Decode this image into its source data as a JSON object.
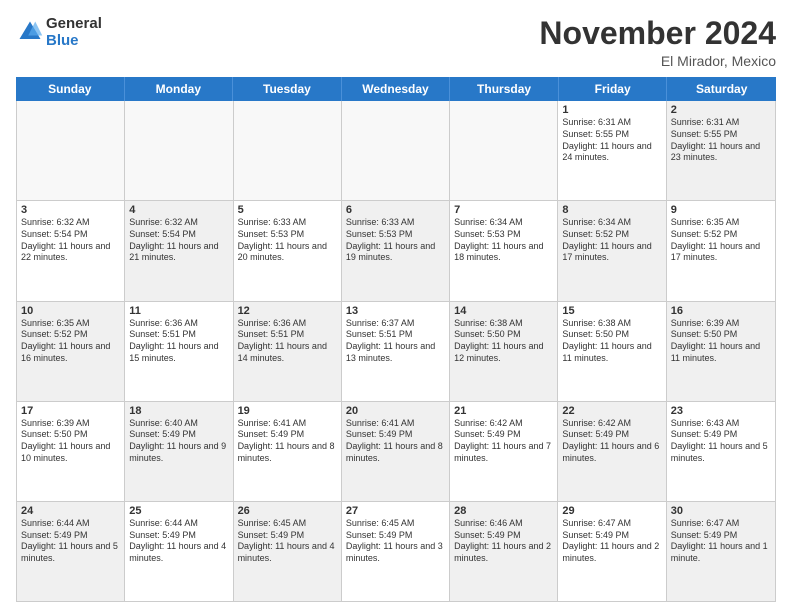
{
  "logo": {
    "general": "General",
    "blue": "Blue"
  },
  "header": {
    "month": "November 2024",
    "location": "El Mirador, Mexico"
  },
  "weekdays": [
    "Sunday",
    "Monday",
    "Tuesday",
    "Wednesday",
    "Thursday",
    "Friday",
    "Saturday"
  ],
  "weeks": [
    [
      {
        "day": "",
        "info": "",
        "empty": true
      },
      {
        "day": "",
        "info": "",
        "empty": true
      },
      {
        "day": "",
        "info": "",
        "empty": true
      },
      {
        "day": "",
        "info": "",
        "empty": true
      },
      {
        "day": "",
        "info": "",
        "empty": true
      },
      {
        "day": "1",
        "info": "Sunrise: 6:31 AM\nSunset: 5:55 PM\nDaylight: 11 hours and 24 minutes.",
        "empty": false
      },
      {
        "day": "2",
        "info": "Sunrise: 6:31 AM\nSunset: 5:55 PM\nDaylight: 11 hours and 23 minutes.",
        "empty": false,
        "shaded": true
      }
    ],
    [
      {
        "day": "3",
        "info": "Sunrise: 6:32 AM\nSunset: 5:54 PM\nDaylight: 11 hours and 22 minutes.",
        "empty": false
      },
      {
        "day": "4",
        "info": "Sunrise: 6:32 AM\nSunset: 5:54 PM\nDaylight: 11 hours and 21 minutes.",
        "empty": false,
        "shaded": true
      },
      {
        "day": "5",
        "info": "Sunrise: 6:33 AM\nSunset: 5:53 PM\nDaylight: 11 hours and 20 minutes.",
        "empty": false
      },
      {
        "day": "6",
        "info": "Sunrise: 6:33 AM\nSunset: 5:53 PM\nDaylight: 11 hours and 19 minutes.",
        "empty": false,
        "shaded": true
      },
      {
        "day": "7",
        "info": "Sunrise: 6:34 AM\nSunset: 5:53 PM\nDaylight: 11 hours and 18 minutes.",
        "empty": false
      },
      {
        "day": "8",
        "info": "Sunrise: 6:34 AM\nSunset: 5:52 PM\nDaylight: 11 hours and 17 minutes.",
        "empty": false,
        "shaded": true
      },
      {
        "day": "9",
        "info": "Sunrise: 6:35 AM\nSunset: 5:52 PM\nDaylight: 11 hours and 17 minutes.",
        "empty": false
      }
    ],
    [
      {
        "day": "10",
        "info": "Sunrise: 6:35 AM\nSunset: 5:52 PM\nDaylight: 11 hours and 16 minutes.",
        "empty": false,
        "shaded": true
      },
      {
        "day": "11",
        "info": "Sunrise: 6:36 AM\nSunset: 5:51 PM\nDaylight: 11 hours and 15 minutes.",
        "empty": false
      },
      {
        "day": "12",
        "info": "Sunrise: 6:36 AM\nSunset: 5:51 PM\nDaylight: 11 hours and 14 minutes.",
        "empty": false,
        "shaded": true
      },
      {
        "day": "13",
        "info": "Sunrise: 6:37 AM\nSunset: 5:51 PM\nDaylight: 11 hours and 13 minutes.",
        "empty": false
      },
      {
        "day": "14",
        "info": "Sunrise: 6:38 AM\nSunset: 5:50 PM\nDaylight: 11 hours and 12 minutes.",
        "empty": false,
        "shaded": true
      },
      {
        "day": "15",
        "info": "Sunrise: 6:38 AM\nSunset: 5:50 PM\nDaylight: 11 hours and 11 minutes.",
        "empty": false
      },
      {
        "day": "16",
        "info": "Sunrise: 6:39 AM\nSunset: 5:50 PM\nDaylight: 11 hours and 11 minutes.",
        "empty": false,
        "shaded": true
      }
    ],
    [
      {
        "day": "17",
        "info": "Sunrise: 6:39 AM\nSunset: 5:50 PM\nDaylight: 11 hours and 10 minutes.",
        "empty": false
      },
      {
        "day": "18",
        "info": "Sunrise: 6:40 AM\nSunset: 5:49 PM\nDaylight: 11 hours and 9 minutes.",
        "empty": false,
        "shaded": true
      },
      {
        "day": "19",
        "info": "Sunrise: 6:41 AM\nSunset: 5:49 PM\nDaylight: 11 hours and 8 minutes.",
        "empty": false
      },
      {
        "day": "20",
        "info": "Sunrise: 6:41 AM\nSunset: 5:49 PM\nDaylight: 11 hours and 8 minutes.",
        "empty": false,
        "shaded": true
      },
      {
        "day": "21",
        "info": "Sunrise: 6:42 AM\nSunset: 5:49 PM\nDaylight: 11 hours and 7 minutes.",
        "empty": false
      },
      {
        "day": "22",
        "info": "Sunrise: 6:42 AM\nSunset: 5:49 PM\nDaylight: 11 hours and 6 minutes.",
        "empty": false,
        "shaded": true
      },
      {
        "day": "23",
        "info": "Sunrise: 6:43 AM\nSunset: 5:49 PM\nDaylight: 11 hours and 5 minutes.",
        "empty": false
      }
    ],
    [
      {
        "day": "24",
        "info": "Sunrise: 6:44 AM\nSunset: 5:49 PM\nDaylight: 11 hours and 5 minutes.",
        "empty": false,
        "shaded": true
      },
      {
        "day": "25",
        "info": "Sunrise: 6:44 AM\nSunset: 5:49 PM\nDaylight: 11 hours and 4 minutes.",
        "empty": false
      },
      {
        "day": "26",
        "info": "Sunrise: 6:45 AM\nSunset: 5:49 PM\nDaylight: 11 hours and 4 minutes.",
        "empty": false,
        "shaded": true
      },
      {
        "day": "27",
        "info": "Sunrise: 6:45 AM\nSunset: 5:49 PM\nDaylight: 11 hours and 3 minutes.",
        "empty": false
      },
      {
        "day": "28",
        "info": "Sunrise: 6:46 AM\nSunset: 5:49 PM\nDaylight: 11 hours and 2 minutes.",
        "empty": false,
        "shaded": true
      },
      {
        "day": "29",
        "info": "Sunrise: 6:47 AM\nSunset: 5:49 PM\nDaylight: 11 hours and 2 minutes.",
        "empty": false
      },
      {
        "day": "30",
        "info": "Sunrise: 6:47 AM\nSunset: 5:49 PM\nDaylight: 11 hours and 1 minute.",
        "empty": false,
        "shaded": true
      }
    ]
  ]
}
